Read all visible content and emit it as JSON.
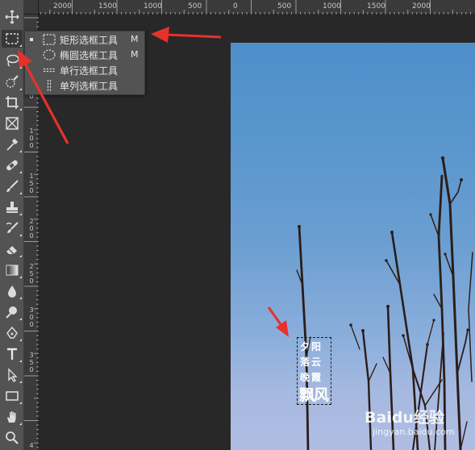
{
  "ruler": {
    "top_labels": [
      "2000",
      "1500",
      "1000",
      "500",
      "0",
      "500",
      "1000",
      "1500",
      "2000"
    ],
    "left_labels": [
      "0",
      "5 0",
      "1 0 0",
      "1 5 0",
      "2 0 0",
      "2 5 0",
      "3 0 0",
      "3 5 0",
      "4"
    ]
  },
  "flyout": {
    "items": [
      {
        "label": "矩形选框工具",
        "shortcut": "M",
        "icon": "rect-marquee-icon",
        "active": true
      },
      {
        "label": "椭圆选框工具",
        "shortcut": "M",
        "icon": "ellipse-marquee-icon",
        "active": false
      },
      {
        "label": "单行选框工具",
        "shortcut": "",
        "icon": "single-row-marquee-icon",
        "active": false
      },
      {
        "label": "单列选框工具",
        "shortcut": "",
        "icon": "single-column-marquee-icon",
        "active": false
      }
    ]
  },
  "toolbar": {
    "tools": [
      "move-tool",
      "marquee-tool",
      "lasso-tool",
      "quick-select-tool",
      "crop-tool",
      "frame-tool",
      "eyedropper-tool",
      "healing-brush-tool",
      "brush-tool",
      "stamp-tool",
      "history-brush-tool",
      "eraser-tool",
      "gradient-tool",
      "blur-tool",
      "dodge-tool",
      "pen-tool",
      "type-tool",
      "path-select-tool",
      "rectangle-tool",
      "hand-tool",
      "zoom-tool"
    ],
    "active": "marquee-tool"
  },
  "canvas": {
    "text_lines": [
      "夕阳",
      "落云",
      "晚霞"
    ],
    "text_big": "飘风"
  },
  "watermark": {
    "brand": "Baidu经验",
    "url": "jingyan.baidu.com"
  },
  "colors": {
    "annotation_arrow": "#e8312b",
    "panel": "#535353",
    "workspace": "#282828"
  }
}
